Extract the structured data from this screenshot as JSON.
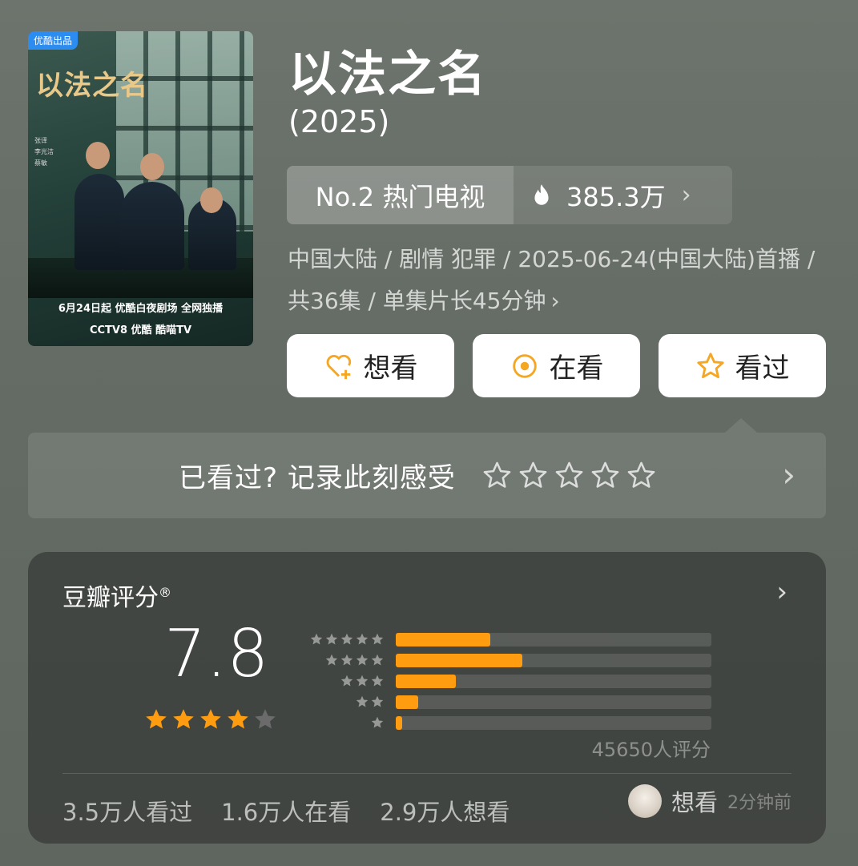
{
  "poster": {
    "badge": "优酷出品",
    "title": "以法之名",
    "cast": [
      "张译",
      "李光洁",
      "蔡敏"
    ],
    "tagline": "6月24日起 优酷白夜剧场 全网独播",
    "logos": "CCTV8 优酷 酷喵TV"
  },
  "header": {
    "title": "以法之名",
    "year": "(2025)"
  },
  "rank": {
    "label": "No.2 热门电视",
    "heat": "385.3万"
  },
  "meta": {
    "text": "中国大陆 / 剧情 犯罪 / 2025-06-24(中国大陆)首播 / 共36集 / 单集片长45分钟"
  },
  "actions": {
    "want": "想看",
    "watching": "在看",
    "watched": "看过"
  },
  "record": {
    "label": "已看过? 记录此刻感受"
  },
  "rating": {
    "title": "豆瓣评分",
    "mark": "®",
    "score": "7.8",
    "stars_filled": 4,
    "count": "45650人评分",
    "distribution": [
      {
        "stars": 5,
        "fraction": 0.3
      },
      {
        "stars": 4,
        "fraction": 0.4
      },
      {
        "stars": 3,
        "fraction": 0.19
      },
      {
        "stars": 2,
        "fraction": 0.07
      },
      {
        "stars": 1,
        "fraction": 0.02
      }
    ],
    "stats": {
      "watched": "3.5万人看过",
      "watching": "1.6万人在看",
      "want": "2.9万人想看"
    },
    "recent": {
      "action": "想看",
      "time": "2分钟前"
    }
  },
  "colors": {
    "accent": "#ff9c0f",
    "star_empty": "#6b6b6b"
  }
}
